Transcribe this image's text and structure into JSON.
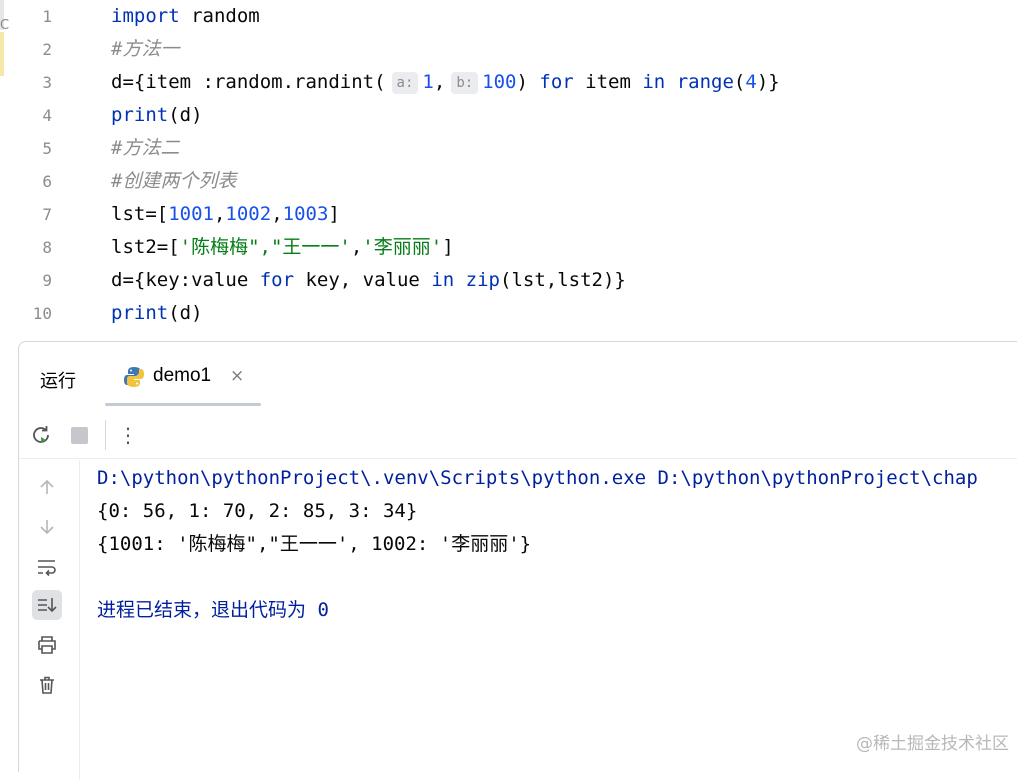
{
  "editor": {
    "edge_char": "C",
    "lines": [
      {
        "num": "1",
        "tokens": [
          {
            "t": "import",
            "c": "kw"
          },
          {
            "t": " random"
          }
        ]
      },
      {
        "num": "2",
        "tokens": [
          {
            "t": "#方法一",
            "c": "cmt"
          }
        ]
      },
      {
        "num": "3",
        "tokens": [
          {
            "t": "d={item :random.randint("
          },
          {
            "t": "a:",
            "c": "hint"
          },
          {
            "t": "1",
            "c": "num"
          },
          {
            "t": ","
          },
          {
            "t": "b:",
            "c": "hint"
          },
          {
            "t": "100",
            "c": "num"
          },
          {
            "t": ") "
          },
          {
            "t": "for",
            "c": "kw"
          },
          {
            "t": " item "
          },
          {
            "t": "in",
            "c": "kw"
          },
          {
            "t": " "
          },
          {
            "t": "range",
            "c": "kw"
          },
          {
            "t": "("
          },
          {
            "t": "4",
            "c": "num"
          },
          {
            "t": ")}"
          }
        ]
      },
      {
        "num": "4",
        "tokens": [
          {
            "t": "print",
            "c": "kw"
          },
          {
            "t": "(d)"
          }
        ]
      },
      {
        "num": "5",
        "tokens": [
          {
            "t": "#方法二",
            "c": "cmt"
          }
        ]
      },
      {
        "num": "6",
        "tokens": [
          {
            "t": "#创建两个列表",
            "c": "cmt"
          }
        ]
      },
      {
        "num": "7",
        "tokens": [
          {
            "t": "lst=["
          },
          {
            "t": "1001",
            "c": "num"
          },
          {
            "t": ","
          },
          {
            "t": "1002",
            "c": "num"
          },
          {
            "t": ","
          },
          {
            "t": "1003",
            "c": "num"
          },
          {
            "t": "]"
          }
        ]
      },
      {
        "num": "8",
        "tokens": [
          {
            "t": "lst2=["
          },
          {
            "t": "'陈梅梅\",\"王一一'",
            "c": "str"
          },
          {
            "t": ","
          },
          {
            "t": "'李丽丽'",
            "c": "str"
          },
          {
            "t": "]"
          }
        ]
      },
      {
        "num": "9",
        "tokens": [
          {
            "t": "d={key:value "
          },
          {
            "t": "for",
            "c": "kw"
          },
          {
            "t": " key, value "
          },
          {
            "t": "in",
            "c": "kw"
          },
          {
            "t": " "
          },
          {
            "t": "zip",
            "c": "kw"
          },
          {
            "t": "(lst,lst2)}"
          }
        ]
      },
      {
        "num": "10",
        "tokens": [
          {
            "t": "print",
            "c": "kw"
          },
          {
            "t": "(d)"
          }
        ]
      }
    ]
  },
  "run_panel": {
    "title": "运行",
    "tab": {
      "label": "demo1",
      "close": "×"
    },
    "toolbar": {
      "rerun": "rerun-icon",
      "stop": "stop-icon",
      "more": "⋮"
    },
    "side_tools": [
      "up-arrow-icon",
      "down-arrow-icon",
      "soft-wrap-icon",
      "scroll-to-end-icon",
      "print-icon",
      "trash-icon"
    ],
    "console": [
      {
        "text": "D:\\python\\pythonProject\\.venv\\Scripts\\python.exe D:\\python\\pythonProject\\chap",
        "kind": "path"
      },
      {
        "text": "{0: 56, 1: 70, 2: 85, 3: 34}",
        "kind": "out"
      },
      {
        "text": "{1001: '陈梅梅\",\"王一一', 1002: '李丽丽'}",
        "kind": "out"
      },
      {
        "text": "",
        "kind": "out"
      },
      {
        "text": "进程已结束，退出代码为 0",
        "kind": "exit"
      }
    ]
  },
  "watermark": "@稀土掘金技术社区",
  "colors": {
    "keyword": "#0033b3",
    "number": "#1750eb",
    "string": "#067d17",
    "comment": "#8c8c8c",
    "console_path": "#001f9e"
  }
}
